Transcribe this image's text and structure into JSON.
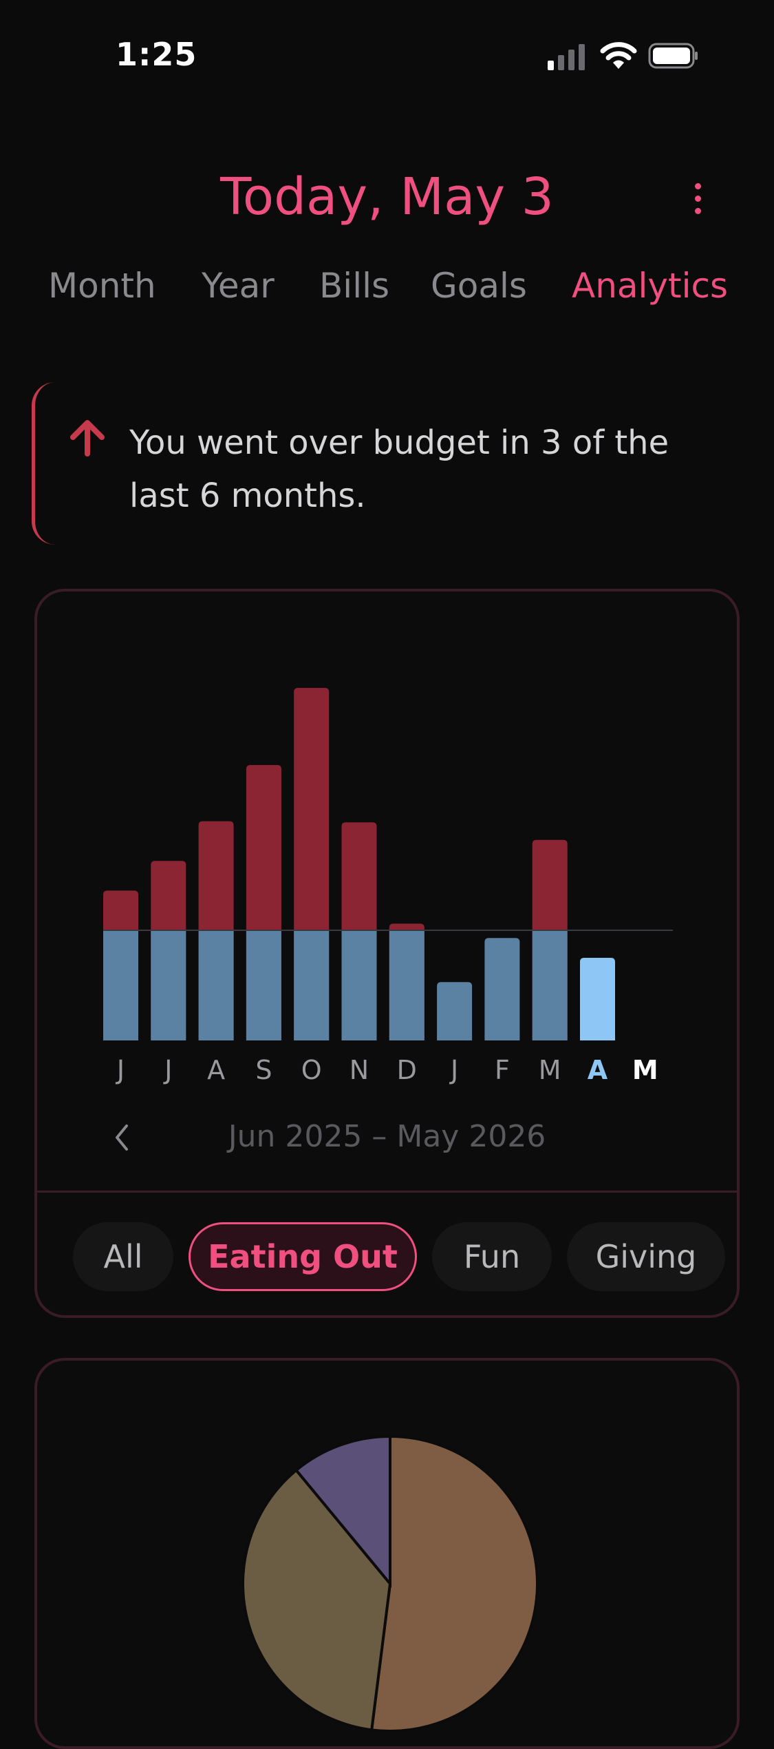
{
  "status_bar": {
    "time": "1:25"
  },
  "header": {
    "title": "Today, May 3"
  },
  "tabs": [
    {
      "label": "Month",
      "active": false
    },
    {
      "label": "Year",
      "active": false
    },
    {
      "label": "Bills",
      "active": false
    },
    {
      "label": "Goals",
      "active": false
    },
    {
      "label": "Analytics",
      "active": true
    }
  ],
  "alert": {
    "icon": "arrow-up-icon",
    "text": "You went over budget in 3 of the last 6 months."
  },
  "colors": {
    "accent": "#f0507f",
    "over_budget": "#8b2533",
    "within_budget": "#5b82a2",
    "current_month": "#8ec7f5",
    "alert_red": "#c63a4c"
  },
  "chart_data": {
    "type": "bar",
    "stacked": true,
    "categories": [
      "J",
      "J",
      "A",
      "S",
      "O",
      "N",
      "D",
      "J",
      "F",
      "M",
      "A",
      "M"
    ],
    "current_index": 10,
    "selected_index": 11,
    "budget_line": 1,
    "series": [
      {
        "values": [
          1,
          1,
          1,
          1,
          1,
          1,
          1,
          0.53,
          0.93,
          1,
          0.75,
          0
        ]
      },
      {
        "values": [
          0.36,
          0.63,
          0.99,
          1.5,
          2.2,
          0.98,
          0.06,
          0,
          0,
          0.82,
          0,
          0
        ]
      }
    ],
    "range_label": "Jun 2025 – May 2026"
  },
  "filters": [
    {
      "label": "All",
      "active": false
    },
    {
      "label": "Eating Out",
      "active": true
    },
    {
      "label": "Fun",
      "active": false
    },
    {
      "label": "Giving",
      "active": false
    }
  ],
  "pie_chart": {
    "type": "pie",
    "slices": [
      {
        "value": 52,
        "color": "#7f5c44"
      },
      {
        "value": 37,
        "color": "#6b5c44"
      },
      {
        "value": 11,
        "color": "#5a5078"
      }
    ]
  }
}
